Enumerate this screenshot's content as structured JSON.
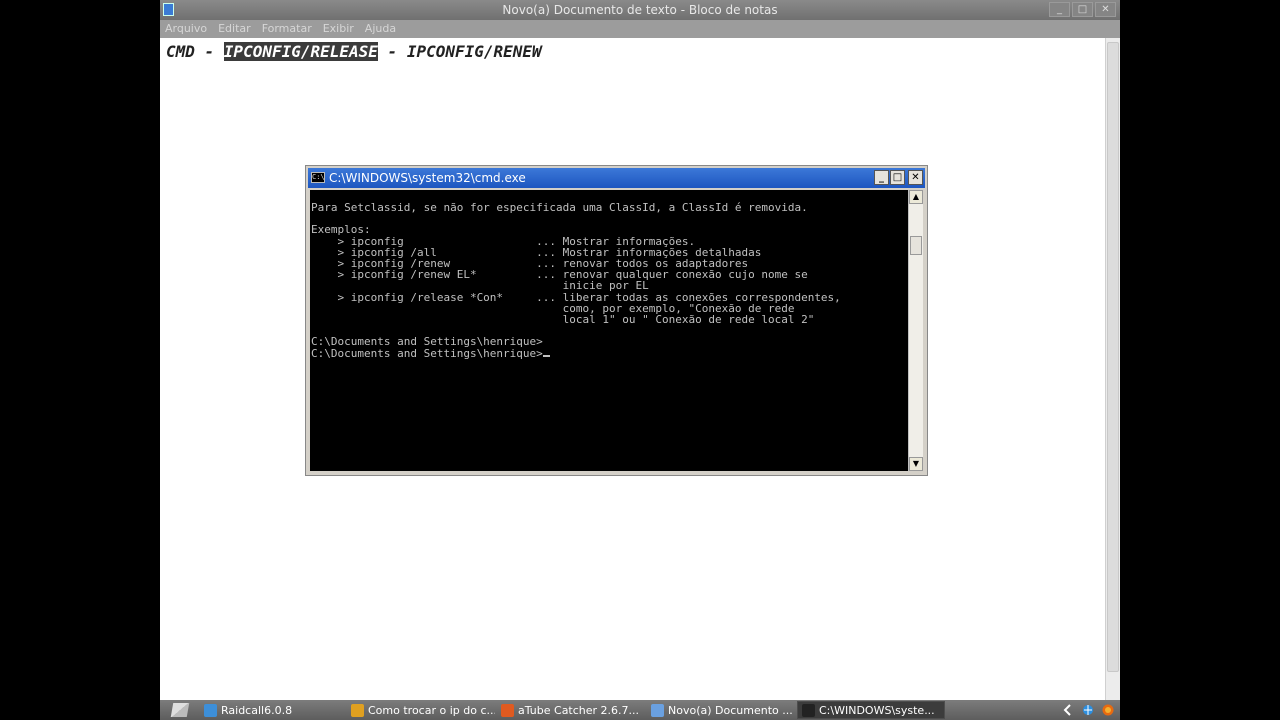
{
  "notepad": {
    "title": "Novo(a) Documento de texto - Bloco de notas",
    "menus": [
      "Arquivo",
      "Editar",
      "Formatar",
      "Exibir",
      "Ajuda"
    ],
    "text_before": "CMD - ",
    "text_selected": "IPCONFIG/RELEASE",
    "text_after": " - IPCONFIG/RENEW"
  },
  "cmd": {
    "title": "C:\\WINDOWS\\system32\\cmd.exe",
    "lines": [
      "Para Setclassid, se não for especificada uma ClassId, a ClassId é removida.",
      "",
      "Exemplos:",
      "    > ipconfig                    ... Mostrar informações.",
      "    > ipconfig /all               ... Mostrar informações detalhadas",
      "    > ipconfig /renew             ... renovar todos os adaptadores",
      "    > ipconfig /renew EL*         ... renovar qualquer conexão cujo nome se",
      "                                      inicie por EL",
      "    > ipconfig /release *Con*     ... liberar todas as conexões correspondentes,",
      "                                      como, por exemplo, \"Conexão de rede",
      "                                      local 1\" ou \" Conexão de rede local 2\"",
      "",
      "C:\\Documents and Settings\\henrique>",
      "C:\\Documents and Settings\\henrique>"
    ]
  },
  "taskbar": {
    "tasks": [
      {
        "label": "Raidcall6.0.8",
        "icon": "raidcall-icon",
        "color": "#3d8fd9",
        "active": false
      },
      {
        "label": "Como trocar o ip do c...",
        "icon": "chrome-icon",
        "color": "#e0a020",
        "active": false
      },
      {
        "label": "aTube Catcher 2.6.7...",
        "icon": "atube-icon",
        "color": "#e05a20",
        "active": false
      },
      {
        "label": "Novo(a) Documento ...",
        "icon": "notepad-icon",
        "color": "#6aa0e0",
        "active": false
      },
      {
        "label": "C:\\WINDOWS\\syste...",
        "icon": "cmd-icon",
        "color": "#222222",
        "active": true
      }
    ]
  }
}
